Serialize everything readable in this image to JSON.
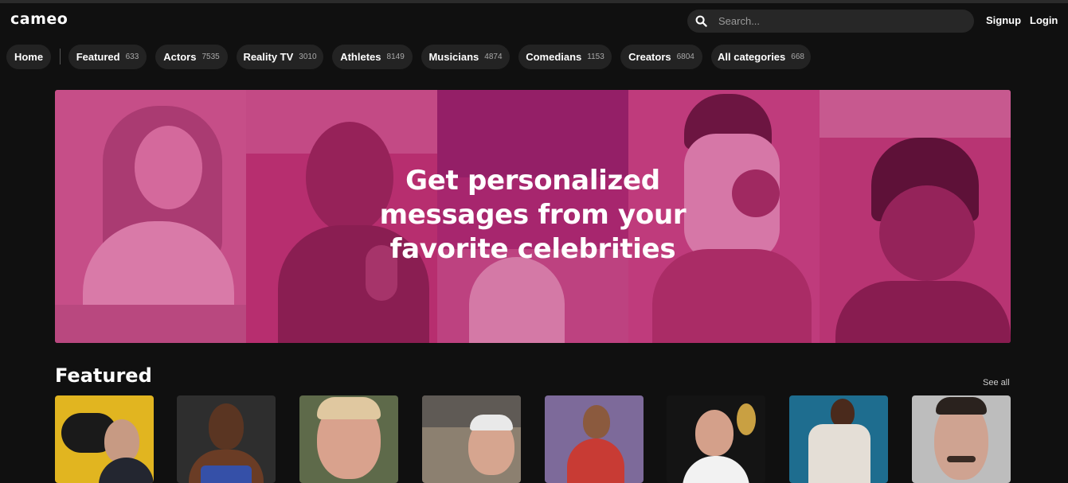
{
  "header": {
    "logo": "cameo",
    "search_placeholder": "Search...",
    "signup": "Signup",
    "login": "Login"
  },
  "nav": {
    "home": "Home",
    "categories": [
      {
        "label": "Featured",
        "count": "633"
      },
      {
        "label": "Actors",
        "count": "7535"
      },
      {
        "label": "Reality TV",
        "count": "3010"
      },
      {
        "label": "Athletes",
        "count": "8149"
      },
      {
        "label": "Musicians",
        "count": "4874"
      },
      {
        "label": "Comedians",
        "count": "1153"
      },
      {
        "label": "Creators",
        "count": "6804"
      },
      {
        "label": "All categories",
        "count": "668"
      }
    ]
  },
  "hero": {
    "line1": "Get personalized",
    "line2": "messages from your",
    "line3": "favorite celebrities"
  },
  "featured": {
    "title": "Featured",
    "see_all": "See all"
  },
  "colors": {
    "background": "#101010",
    "pill": "#232323",
    "hero_pink": "#c2407f"
  }
}
